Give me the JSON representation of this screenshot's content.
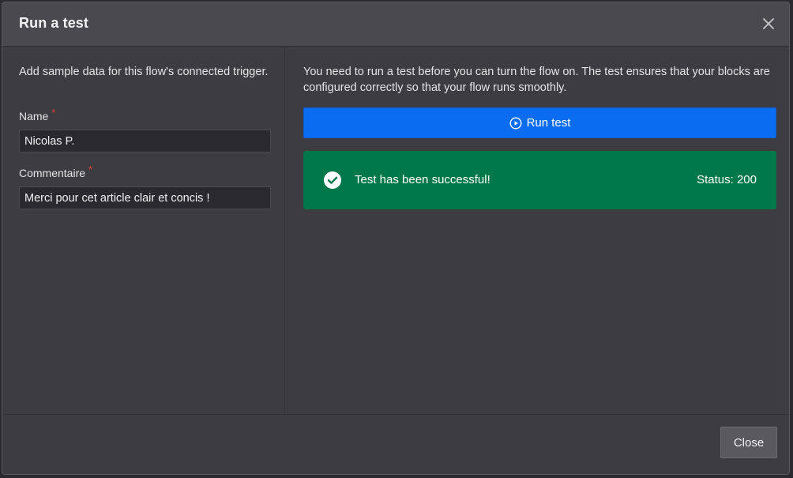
{
  "dialog": {
    "title": "Run a test",
    "close_icon": "close-icon"
  },
  "left": {
    "intro": "Add sample data for this flow's connected trigger.",
    "fields": [
      {
        "label": "Name",
        "required_mark": "*",
        "value": "Nicolas P."
      },
      {
        "label": "Commentaire",
        "required_mark": "*",
        "value": "Merci pour cet article clair et concis !"
      }
    ]
  },
  "right": {
    "description": "You need to run a test before you can turn the flow on. The test ensures that your blocks are configured correctly so that your flow runs smoothly.",
    "run_button": {
      "label": "Run test",
      "icon": "play-circle-icon"
    },
    "result": {
      "icon": "check-circle-icon",
      "message": "Test has been successful!",
      "status": "Status: 200"
    }
  },
  "footer": {
    "close_label": "Close"
  },
  "colors": {
    "accent": "#0a6cf0",
    "success": "#00784a",
    "required": "#e0433a"
  }
}
